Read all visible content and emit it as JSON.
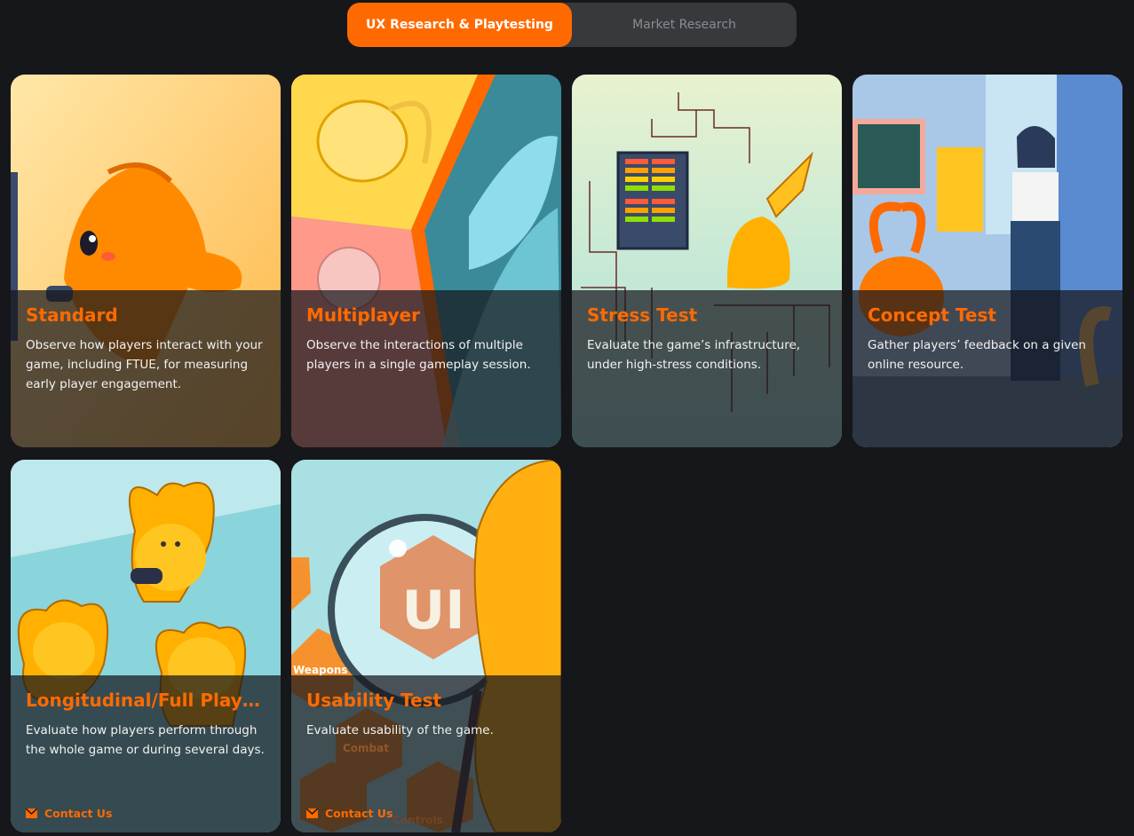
{
  "tabs": [
    {
      "label": "UX Research & Playtesting",
      "active": true
    },
    {
      "label": "Market Research",
      "active": false
    }
  ],
  "cards": [
    {
      "title": "Standard",
      "description": "Observe how players interact with your game, including FTUE, for measuring early player engagement."
    },
    {
      "title": "Multiplayer",
      "description": "Observe the interactions of multiple players in a single gameplay session."
    },
    {
      "title": "Stress Test",
      "description": "Evaluate the game’s infrastructure, under high-stress conditions."
    },
    {
      "title": "Concept Test",
      "description": "Gather players’ feedback on a given online resource."
    },
    {
      "title": "Longitudinal/Full Playthrough",
      "description": "Evaluate how players perform through the whole game or during several days.",
      "contact": "Contact Us"
    },
    {
      "title": "Usability Test",
      "description": "Evaluate usability of the game.",
      "contact": "Contact Us",
      "art_labels": [
        "UI",
        "Weapons",
        "Combat",
        "Controls"
      ]
    }
  ],
  "colors": {
    "accent": "#ff6a00",
    "background": "#16171b",
    "tab_inactive": "#38393d"
  },
  "icons": {
    "contact": "mail-icon"
  }
}
